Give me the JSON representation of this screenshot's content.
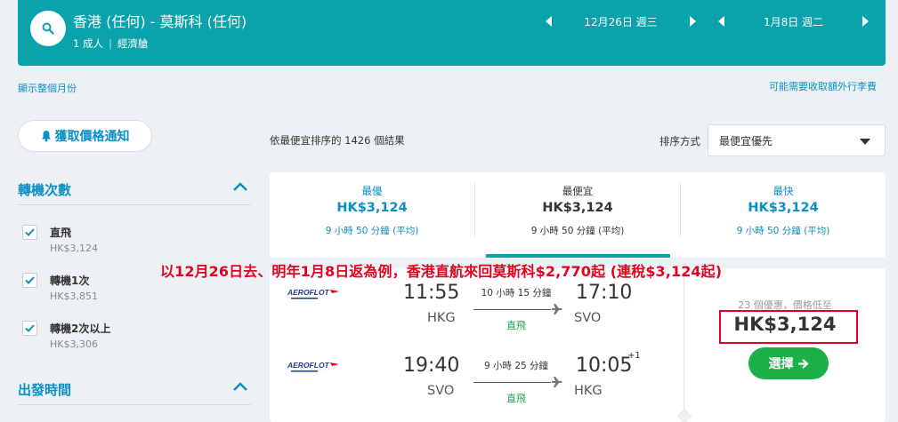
{
  "search": {
    "route": "香港 (任何) - 莫斯科 (任何)",
    "passengers": "1 成人",
    "cabin": "經濟艙",
    "depart_date": "12月26日 週三",
    "return_date": "1月8日 週二"
  },
  "links": {
    "show_month": "顯示整個月份",
    "baggage_fees": "可能需要收取額外行李費"
  },
  "alert_button": "獲取價格通知",
  "filters": {
    "stops_title": "轉機次數",
    "options": [
      {
        "label": "直飛",
        "price": "HK$3,124",
        "checked": true
      },
      {
        "label": "轉機1次",
        "price": "HK$3,851",
        "checked": true
      },
      {
        "label": "轉機2次以上",
        "price": "HK$3,306",
        "checked": true
      }
    ],
    "departure_title": "出發時間"
  },
  "results": {
    "count_text": "依最便宜排序的 1426 個結果",
    "sort_label": "排序方式",
    "sort_value": "最便宜優先"
  },
  "tabs": [
    {
      "name": "最優",
      "price": "HK$3,124",
      "duration": "9 小時 50 分鐘 (平均)"
    },
    {
      "name": "最便宜",
      "price": "HK$3,124",
      "duration": "9 小時 50 分鐘 (平均)"
    },
    {
      "name": "最快",
      "price": "HK$3,124",
      "duration": "9 小時 50 分鐘 (平均)"
    }
  ],
  "annotation": "以12月26日去、明年1月8日返為例，香港直航來回莫斯科$2,770起 (連稅$3,124起)",
  "result": {
    "airline": "AEROFLOT",
    "outbound": {
      "dep_time": "11:55",
      "dep_airport": "HKG",
      "arr_time": "17:10",
      "arr_airport": "SVO",
      "duration": "10 小時 15 分鐘",
      "stops": "直飛"
    },
    "inbound": {
      "dep_time": "19:40",
      "dep_airport": "SVO",
      "arr_time": "10:05",
      "arr_airport": "HKG",
      "duration": "9 小時 25 分鐘",
      "stops": "直飛",
      "plus_day": "+1"
    },
    "deals_text": "23 個優惠，價格低至",
    "price": "HK$3,124",
    "select_label": "選擇"
  },
  "colors": {
    "header_bg": "#0aa2ab",
    "link_blue": "#0a8fc7",
    "select_green": "#1ab046",
    "annotation_red": "#e6001f"
  }
}
